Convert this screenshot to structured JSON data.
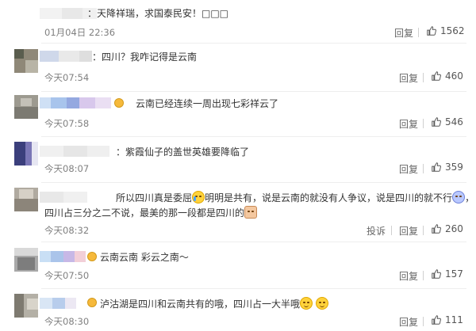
{
  "comments": [
    {
      "text": "：天降祥瑞，求国泰民安！□□□",
      "time": "01月04日 22:36",
      "reply": "回复",
      "likes": "1562"
    },
    {
      "text": "：四川？我咋记得是云南",
      "time": "今天07:54",
      "reply": "回复",
      "likes": "460"
    },
    {
      "text": "云南已经连续一周出现七彩祥云了",
      "time": "今天07:58",
      "reply": "回复",
      "likes": "546"
    },
    {
      "text": "：紫霞仙子的盖世英雄要降临了",
      "time": "今天08:07",
      "reply": "回复",
      "likes": "359"
    },
    {
      "text_a": "所以四川真是委屈",
      "text_b": "明明是共有，说是云南的就没有人争议，说是四川的就不行",
      "text_c": "，",
      "text_line2": "四川占三分之二不说，最美的那一段都是四川的",
      "time": "今天08:32",
      "report": "投诉",
      "reply": "回复",
      "likes": "260"
    },
    {
      "text": "云南云南 彩云之南～",
      "time": "今天07:50",
      "reply": "回复",
      "likes": "157"
    },
    {
      "text": "泸沽湖是四川和云南共有的哦，四川占一大半哦",
      "time": "今天08:30",
      "reply": "回复",
      "likes": "111"
    }
  ],
  "colors": {
    "text": "#333333",
    "time": "#808080",
    "action": "#666666",
    "divider": "#eeeeee"
  },
  "icons": {
    "like": "thumbs-up-icon",
    "badge": "member-badge-icon"
  }
}
